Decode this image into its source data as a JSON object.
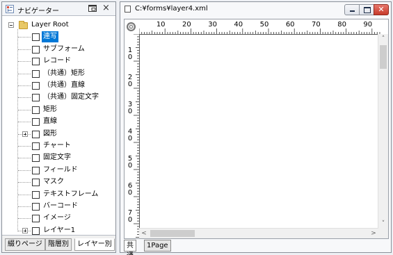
{
  "navigator": {
    "title": "ナビゲーター",
    "close_glyph": "×",
    "restore_icon": "restore-window-icon",
    "tree": [
      {
        "label": "Layer Root",
        "depth": 0,
        "expander": "minus",
        "icon": "folder-icon",
        "checkbox": false,
        "selected": false
      },
      {
        "label": "連写",
        "depth": 1,
        "expander": null,
        "checkbox": true,
        "selected": true
      },
      {
        "label": "サブフォーム",
        "depth": 1,
        "expander": null,
        "checkbox": true,
        "selected": false
      },
      {
        "label": "レコード",
        "depth": 1,
        "expander": null,
        "checkbox": true,
        "selected": false
      },
      {
        "label": "（共通）矩形",
        "depth": 1,
        "expander": null,
        "checkbox": true,
        "selected": false
      },
      {
        "label": "（共通）直線",
        "depth": 1,
        "expander": null,
        "checkbox": true,
        "selected": false
      },
      {
        "label": "（共通）固定文字",
        "depth": 1,
        "expander": null,
        "checkbox": true,
        "selected": false
      },
      {
        "label": "矩形",
        "depth": 1,
        "expander": null,
        "checkbox": true,
        "selected": false
      },
      {
        "label": "直線",
        "depth": 1,
        "expander": null,
        "checkbox": true,
        "selected": false
      },
      {
        "label": "図形",
        "depth": 1,
        "expander": "plus",
        "checkbox": true,
        "selected": false
      },
      {
        "label": "チャート",
        "depth": 1,
        "expander": null,
        "checkbox": true,
        "selected": false
      },
      {
        "label": "固定文字",
        "depth": 1,
        "expander": null,
        "checkbox": true,
        "selected": false
      },
      {
        "label": "フィールド",
        "depth": 1,
        "expander": null,
        "checkbox": true,
        "selected": false
      },
      {
        "label": "マスク",
        "depth": 1,
        "expander": null,
        "checkbox": true,
        "selected": false
      },
      {
        "label": "テキストフレーム",
        "depth": 1,
        "expander": null,
        "checkbox": true,
        "selected": false
      },
      {
        "label": "バーコード",
        "depth": 1,
        "expander": null,
        "checkbox": true,
        "selected": false
      },
      {
        "label": "イメージ",
        "depth": 1,
        "expander": null,
        "checkbox": true,
        "selected": false
      },
      {
        "label": "レイヤー1",
        "depth": 1,
        "expander": "plus",
        "checkbox": true,
        "selected": false
      }
    ],
    "tabs": [
      {
        "label": "綴りページ",
        "active": false
      },
      {
        "label": "階層別",
        "active": false
      },
      {
        "label": "レイヤー別",
        "active": true
      }
    ]
  },
  "document": {
    "title": "C:¥forms¥layer4.xml",
    "close_glyph": "✕",
    "ruler": {
      "horizontal_labels": [
        "10",
        "20",
        "30",
        "40",
        "50",
        "60",
        "70",
        "80",
        "90"
      ],
      "vertical_labels": [
        "1\n0",
        "2\n0",
        "3\n0",
        "4\n0",
        "5\n0",
        "6\n0",
        "7\n0"
      ]
    },
    "scroll_arrows": {
      "up": "˄",
      "down": "˅",
      "left": "<",
      "right": ">"
    },
    "tabs": [
      {
        "label": "共通",
        "active": true
      },
      {
        "label": "1Page",
        "active": false
      }
    ]
  }
}
